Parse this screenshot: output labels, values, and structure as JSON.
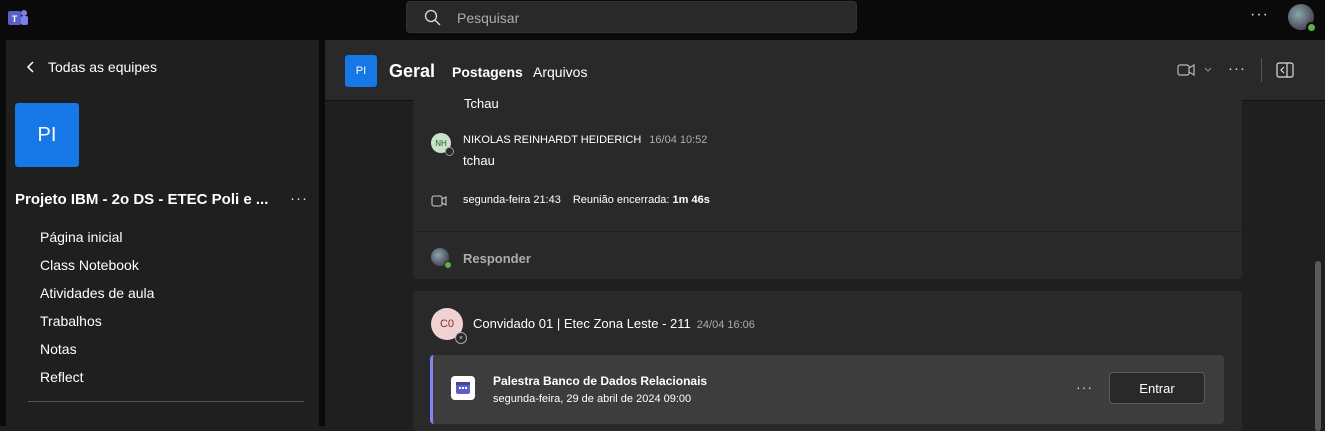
{
  "topbar": {
    "search_placeholder": "Pesquisar",
    "more": "···"
  },
  "sidebar": {
    "back_label": "Todas as equipes",
    "team_initials": "PI",
    "team_name": "Projeto IBM - 2o DS - ETEC Poli e ...",
    "team_more": "···",
    "items": [
      {
        "label": "Página inicial"
      },
      {
        "label": "Class Notebook"
      },
      {
        "label": "Atividades de aula"
      },
      {
        "label": "Trabalhos"
      },
      {
        "label": "Notas"
      },
      {
        "label": "Reflect"
      }
    ]
  },
  "header": {
    "channel_initials": "PI",
    "channel_name": "Geral",
    "tabs": [
      {
        "label": "Postagens"
      },
      {
        "label": "Arquivos"
      }
    ],
    "more": "···"
  },
  "thread": {
    "previous_message": "Tchau",
    "message": {
      "initials": "NH",
      "author": "NIKOLAS REINHARDT HEIDERICH",
      "time": "16/04 10:52",
      "body": "tchau"
    },
    "meeting": {
      "day": "segunda-feira 21:43",
      "ended_label": "Reunião encerrada:",
      "duration": "1m 46s"
    },
    "reply_label": "Responder"
  },
  "post": {
    "initials": "C0",
    "author": "Convidado 01 | Etec Zona Leste - 211",
    "time": "24/04 16:06",
    "event": {
      "title": "Palestra Banco de Dados Relacionais",
      "date": "segunda-feira, 29 de abril de 2024 09:00",
      "more": "···",
      "join_label": "Entrar"
    }
  },
  "colors": {
    "accent": "#7f85f5",
    "team_tile": "#1677e6",
    "presence": "#5fb03f"
  }
}
